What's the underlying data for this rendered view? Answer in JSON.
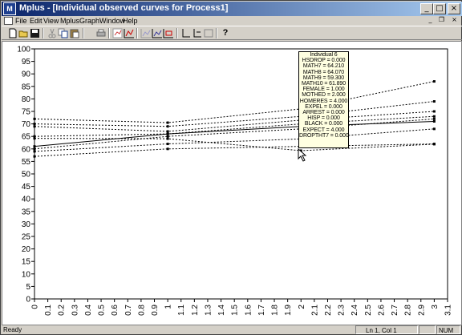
{
  "window": {
    "title": "Mplus - [Individual observed curves for Process1]",
    "icon_label": "M",
    "minimize_glyph": "_",
    "maximize_glyph": "□",
    "close_glyph": "×"
  },
  "menu": {
    "items": [
      "File",
      "Edit",
      "View",
      "Mplus",
      "Graph",
      "Window",
      "Help"
    ],
    "doc_minimize_glyph": "_",
    "doc_restore_glyph": "❐",
    "doc_close_glyph": "×"
  },
  "toolbar": {
    "buttons": [
      "new-icon",
      "open-icon",
      "save-icon",
      "cut-icon",
      "copy-icon",
      "paste-icon",
      "print-icon",
      "chart-icon",
      "chart2-icon",
      "bar-chart-icon",
      "line-chart-icon",
      "chart-options-icon",
      "axis-icon",
      "axis2-icon",
      "axis3-icon",
      "help-icon"
    ],
    "help_glyph": "?"
  },
  "tooltip": {
    "lines": [
      "Individual 6",
      "HSDROP = 0.000",
      "MATH7 = 64.210",
      "MATH8 = 64.070",
      "MATH9 = 59.300",
      "MATH10 = 61.890",
      "FEMALE = 1.000",
      "MOTHED = 2.000",
      "HOMERES = 4.000",
      "EXPEL = 0.000",
      "ARREST = 0.000",
      "HISP = 0.000",
      "BLACK = 0.000",
      "EXPECT = 4.000",
      "DROPTHT7 = 0.000"
    ]
  },
  "statusbar": {
    "ready": "Ready",
    "position": "Ln 1, Col 1",
    "num": "NUM"
  },
  "chart_data": {
    "type": "line",
    "xlim": [
      0,
      3.1
    ],
    "ylim": [
      0,
      100
    ],
    "x_ticks": [
      "0",
      "0.1",
      "0.2",
      "0.3",
      "0.4",
      "0.5",
      "0.6",
      "0.7",
      "0.8",
      "0.9",
      "1",
      "1.1",
      "1.2",
      "1.3",
      "1.4",
      "1.5",
      "1.6",
      "1.7",
      "1.8",
      "1.9",
      "2",
      "2.1",
      "2.2",
      "2.3",
      "2.4",
      "2.5",
      "2.6",
      "2.7",
      "2.8",
      "2.9",
      "3",
      "3.1"
    ],
    "y_ticks": [
      "0",
      "5",
      "10",
      "15",
      "20",
      "25",
      "30",
      "35",
      "40",
      "45",
      "50",
      "55",
      "60",
      "65",
      "70",
      "75",
      "80",
      "85",
      "90",
      "95",
      "100"
    ],
    "x": [
      0,
      1,
      2,
      3
    ],
    "series": [
      {
        "values": [
          72,
          70.5,
          76,
          87
        ],
        "style": "dotted"
      },
      {
        "values": [
          70,
          69,
          73,
          79
        ],
        "style": "dotted"
      },
      {
        "values": [
          69,
          67,
          71.5,
          75
        ],
        "style": "dotted"
      },
      {
        "values": [
          65,
          66,
          70,
          73
        ],
        "style": "dotted"
      },
      {
        "values": [
          61,
          66,
          69,
          71
        ],
        "style": "solid"
      },
      {
        "values": [
          60,
          65,
          68,
          72
        ],
        "style": "dotted"
      },
      {
        "values": [
          64.21,
          64.07,
          59.3,
          61.89
        ],
        "style": "dotted"
      },
      {
        "values": [
          59,
          62,
          64,
          68
        ],
        "style": "dotted"
      },
      {
        "values": [
          57,
          60,
          61,
          62
        ],
        "style": "dotted"
      }
    ],
    "line_color": "#000000",
    "grid": false
  }
}
